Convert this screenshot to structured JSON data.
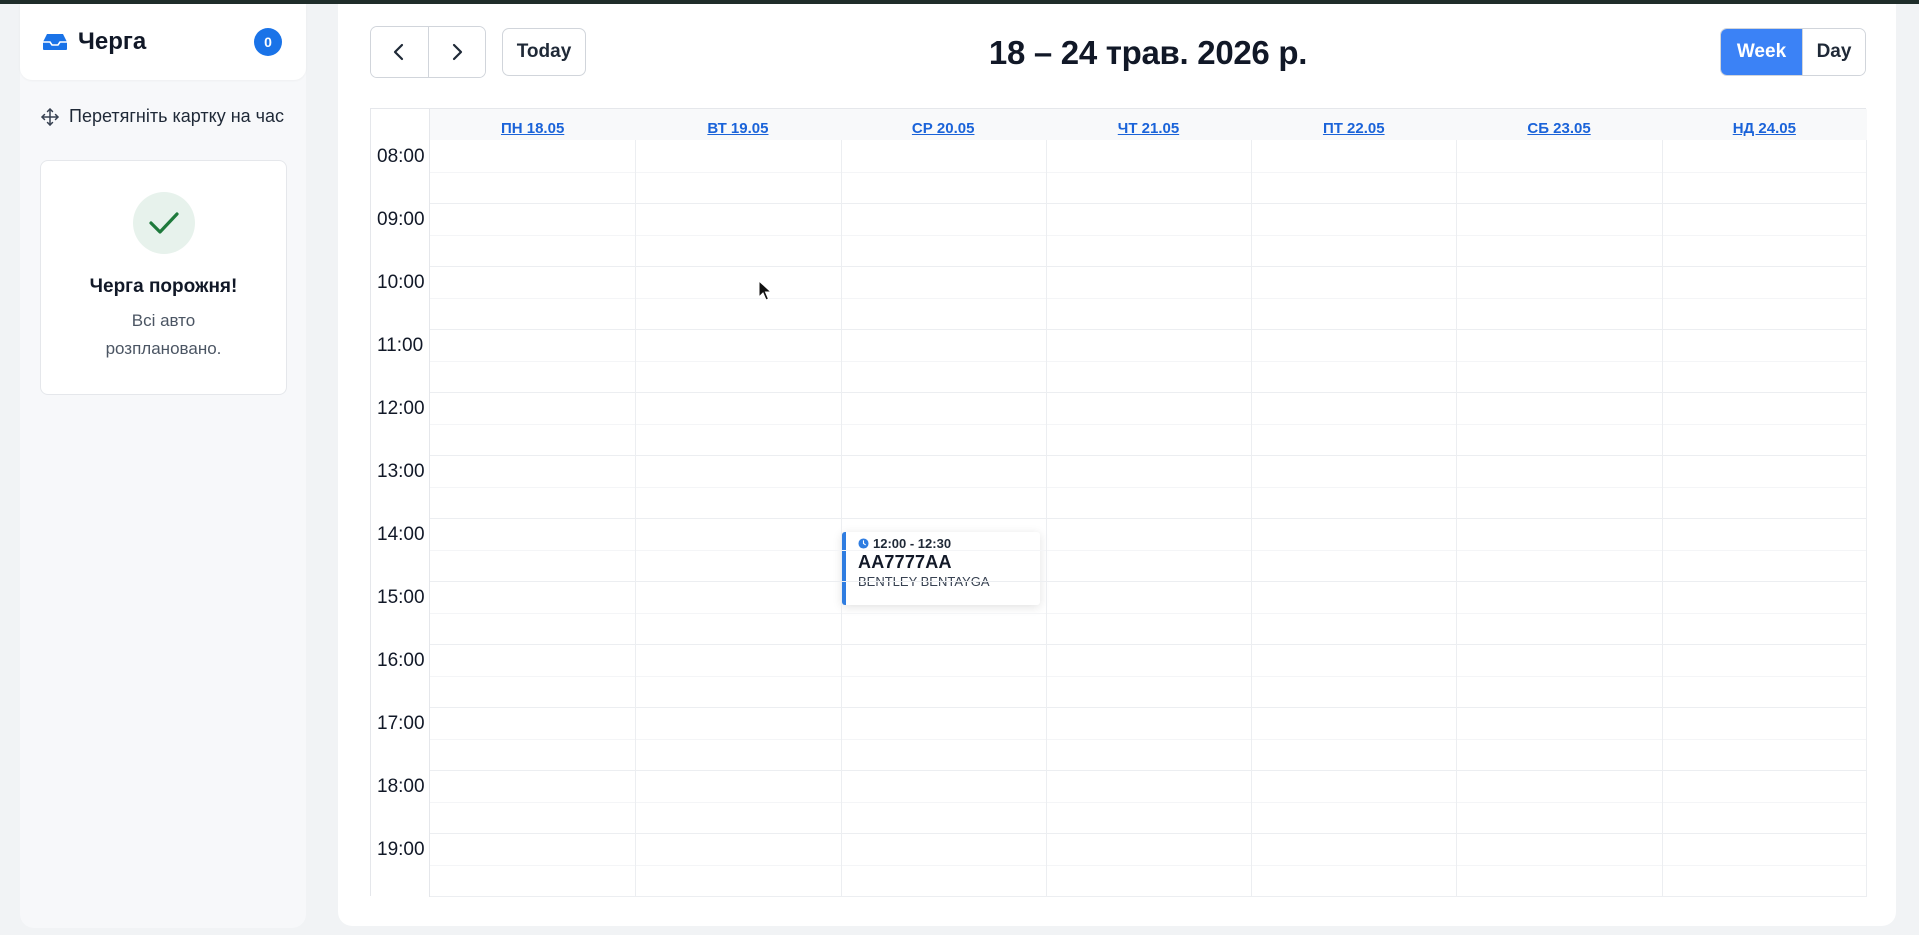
{
  "sidebar": {
    "title": "Черга",
    "badge": "0",
    "hint": "Перетягніть картку на час",
    "empty": {
      "title": "Черга порожня!",
      "subtitle": "Всі авто розплановано."
    }
  },
  "toolbar": {
    "today_label": "Today",
    "range_title": "18 – 24 трав. 2026 р.",
    "views": {
      "week": "Week",
      "day": "Day"
    },
    "active_view": "week"
  },
  "calendar": {
    "days": [
      "ПН 18.05",
      "ВТ 19.05",
      "СР 20.05",
      "ЧТ 21.05",
      "ПТ 22.05",
      "СБ 23.05",
      "НД 24.05"
    ],
    "hours": [
      "08:00",
      "09:00",
      "10:00",
      "11:00",
      "12:00",
      "13:00",
      "14:00",
      "15:00",
      "16:00",
      "17:00",
      "18:00",
      "19:00"
    ],
    "event": {
      "time": "12:00 - 12:30",
      "plate": "AA7777AA",
      "model": "BENTLEY BENTAYGA"
    }
  },
  "colors": {
    "accent": "#3b82f6",
    "link": "#1a63d9",
    "badge": "#1a73e8",
    "success": "#1e7a3c",
    "event_border": "#2f7de1"
  }
}
